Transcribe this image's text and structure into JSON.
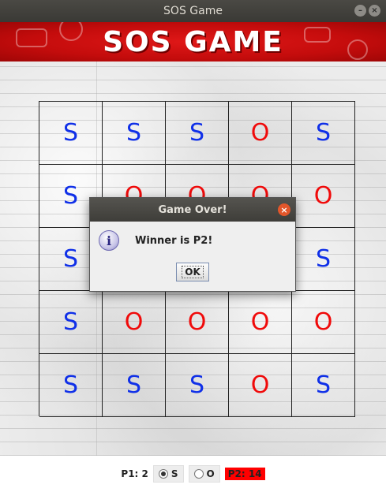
{
  "window": {
    "title": "SOS Game",
    "minimize_icon": "minimize-icon",
    "close_icon": "close-icon"
  },
  "banner": {
    "title": "SOS GAME",
    "background_color": "#d41010"
  },
  "board": {
    "rows": 5,
    "cols": 5,
    "cells": [
      [
        "S",
        "S",
        "S",
        "O",
        "S"
      ],
      [
        "S",
        "O",
        "O",
        "O",
        "O"
      ],
      [
        "S",
        "",
        "",
        "",
        "S"
      ],
      [
        "S",
        "O",
        "O",
        "O",
        "O"
      ],
      [
        "S",
        "S",
        "S",
        "O",
        "S"
      ]
    ],
    "s_color": "#1030e8",
    "o_color": "#f00a0a"
  },
  "status": {
    "p1_label": "P1: 2",
    "option_s": "S",
    "option_o": "O",
    "selected": "S",
    "p2_label": "P2: 14",
    "p2_highlight_color": "#ff0000"
  },
  "dialog": {
    "title": "Game Over!",
    "message": "Winner is P2!",
    "ok_label": "OK",
    "icon": "information-icon"
  }
}
